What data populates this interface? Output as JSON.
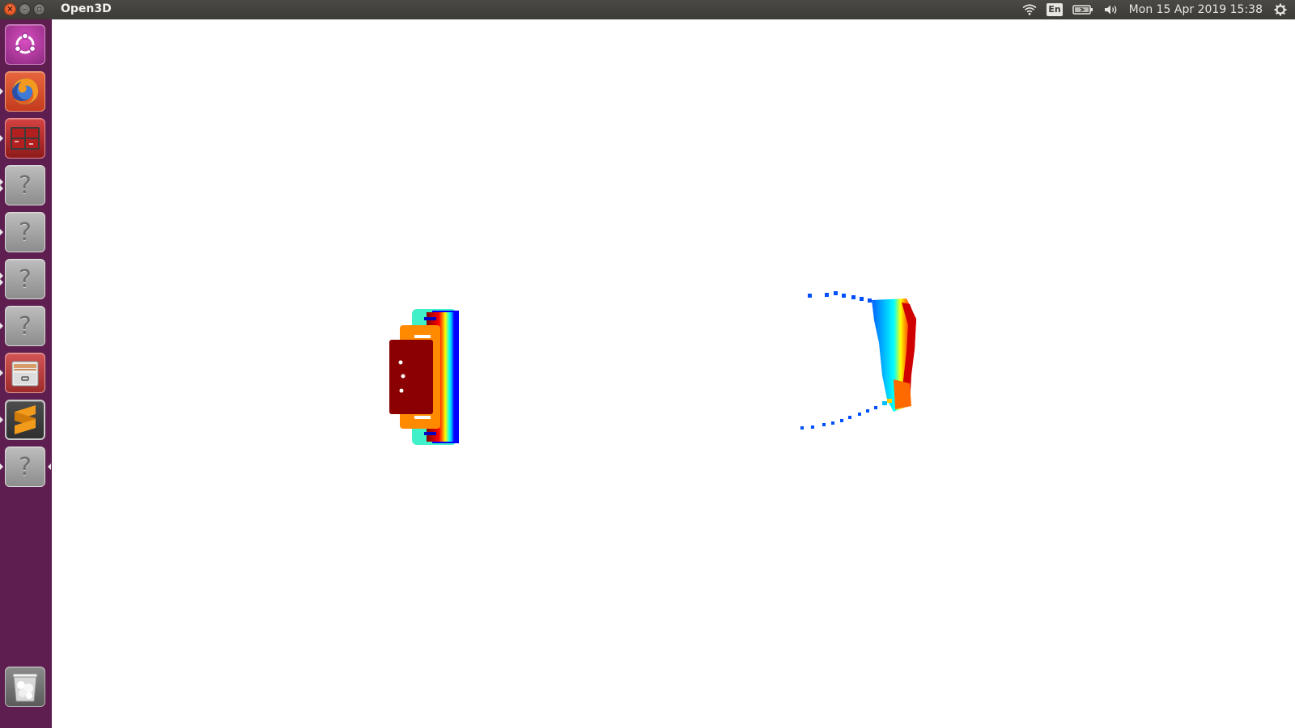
{
  "window": {
    "title": "Open3D",
    "controls": {
      "close_icon": "close-icon",
      "minimize_icon": "minimize-icon",
      "maximize_icon": "maximize-icon"
    }
  },
  "top_panel": {
    "indicators": {
      "wifi_icon": "wifi-icon",
      "language": "En",
      "battery_icon": "battery-icon",
      "volume_icon": "volume-icon",
      "clock": "Mon 15 Apr 2019 15:38",
      "settings_icon": "gear-icon"
    }
  },
  "launcher": {
    "items": [
      {
        "name": "ubuntu-dash",
        "icon": "ubuntu-logo-icon"
      },
      {
        "name": "firefox",
        "icon": "firefox-icon"
      },
      {
        "name": "workspace-switcher",
        "icon": "workspace-icon"
      },
      {
        "name": "unknown-app-1",
        "icon": "question-mark-icon",
        "glyph": "?"
      },
      {
        "name": "unknown-app-2",
        "icon": "question-mark-icon",
        "glyph": "?"
      },
      {
        "name": "unknown-app-3",
        "icon": "question-mark-icon",
        "glyph": "?"
      },
      {
        "name": "unknown-app-4",
        "icon": "question-mark-icon",
        "glyph": "?"
      },
      {
        "name": "files",
        "icon": "file-cabinet-icon"
      },
      {
        "name": "sublime-text",
        "icon": "sublime-text-icon"
      },
      {
        "name": "unknown-app-5",
        "icon": "question-mark-icon",
        "glyph": "?"
      }
    ],
    "trash": {
      "name": "trash",
      "icon": "trash-icon"
    }
  },
  "viewer": {
    "content": "point-cloud-visualization",
    "colors": {
      "background": "#ffffff",
      "colormap": [
        "#00007f",
        "#0000ff",
        "#00a0ff",
        "#00ffff",
        "#7fff7f",
        "#ffff00",
        "#ff8000",
        "#ff0000",
        "#7f0000"
      ]
    }
  }
}
